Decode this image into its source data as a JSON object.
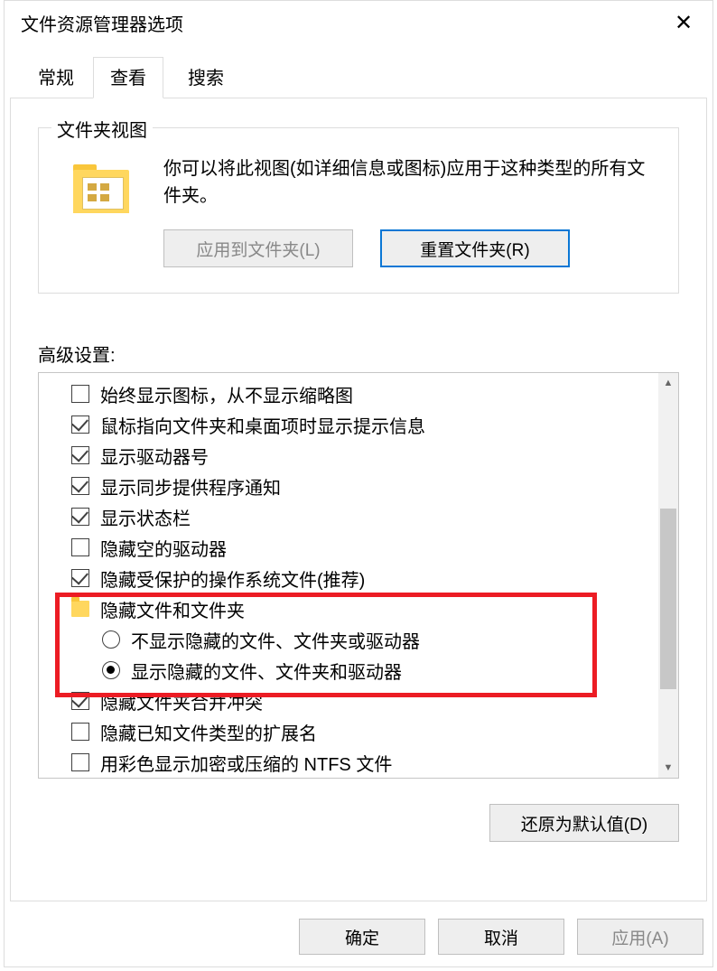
{
  "window": {
    "title": "文件资源管理器选项"
  },
  "tabs": {
    "general": "常规",
    "view": "查看",
    "search": "搜索",
    "active": "view"
  },
  "folderViews": {
    "legend": "文件夹视图",
    "description": "你可以将此视图(如详细信息或图标)应用于这种类型的所有文件夹。",
    "applyBtn": "应用到文件夹(L)",
    "resetBtn": "重置文件夹(R)"
  },
  "advanced": {
    "label": "高级设置:",
    "items": [
      {
        "kind": "check",
        "checked": false,
        "label": "始终显示图标，从不显示缩略图"
      },
      {
        "kind": "check",
        "checked": true,
        "label": "鼠标指向文件夹和桌面项时显示提示信息"
      },
      {
        "kind": "check",
        "checked": true,
        "label": "显示驱动器号"
      },
      {
        "kind": "check",
        "checked": true,
        "label": "显示同步提供程序通知"
      },
      {
        "kind": "check",
        "checked": true,
        "label": "显示状态栏"
      },
      {
        "kind": "check",
        "checked": false,
        "label": "隐藏空的驱动器"
      },
      {
        "kind": "check",
        "checked": true,
        "label": "隐藏受保护的操作系统文件(推荐)"
      },
      {
        "kind": "folder",
        "label": "隐藏文件和文件夹"
      },
      {
        "kind": "radio",
        "selected": false,
        "indent": 1,
        "label": "不显示隐藏的文件、文件夹或驱动器"
      },
      {
        "kind": "radio",
        "selected": true,
        "indent": 1,
        "label": "显示隐藏的文件、文件夹和驱动器"
      },
      {
        "kind": "check",
        "checked": true,
        "label": "隐藏文件夹合并冲突"
      },
      {
        "kind": "check",
        "checked": false,
        "label": "隐藏已知文件类型的扩展名"
      },
      {
        "kind": "check",
        "checked": false,
        "label": "用彩色显示加密或压缩的 NTFS 文件"
      }
    ],
    "restoreBtn": "还原为默认值(D)"
  },
  "buttons": {
    "ok": "确定",
    "cancel": "取消",
    "apply": "应用(A)"
  }
}
